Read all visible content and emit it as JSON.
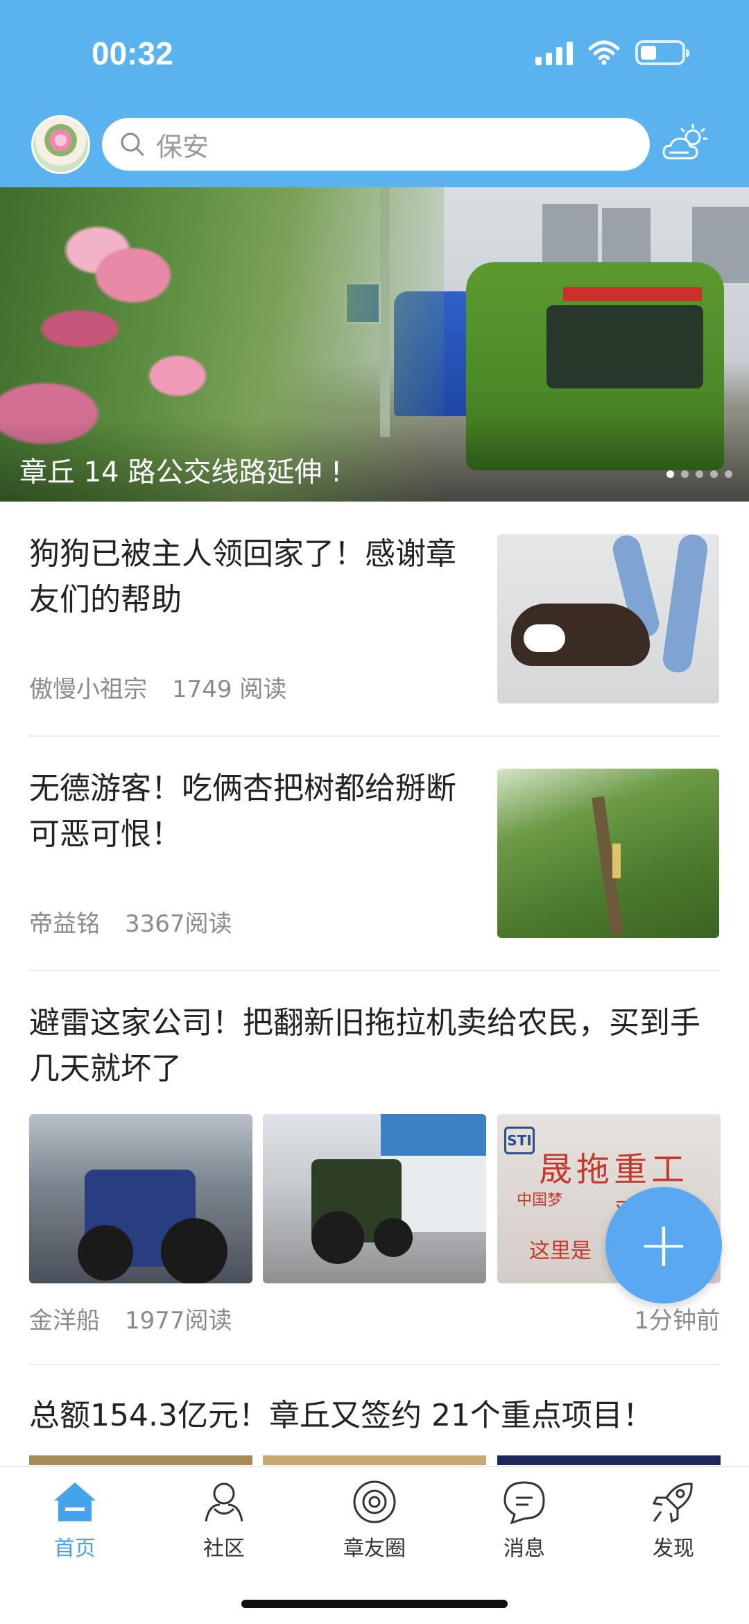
{
  "status_bar": {
    "time": "00:32"
  },
  "header": {
    "search_placeholder": "保安",
    "icons": [
      "avatar",
      "search-icon",
      "weather-cloud-sun-icon"
    ]
  },
  "banner": {
    "caption": "章丘 14 路公交线路延伸 !",
    "slide_count": 5,
    "active_slide": 1
  },
  "articles": [
    {
      "title": "狗狗已被主人领回家了！感谢章友们的帮助",
      "author": "傲慢小祖宗",
      "reads": "1749 阅读"
    },
    {
      "title": "无德游客！吃俩杏把树都给掰断可恶可恨！",
      "author": "帝益铭",
      "reads": "3367阅读"
    },
    {
      "title": "避雷这家公司！把翻新旧拖拉机卖给农民，买到手几天就坏了",
      "author": "金洋船",
      "reads": "1977阅读",
      "time": "1分钟前"
    },
    {
      "title": "总额154.3亿元！章丘又签约 21个重点项目！"
    }
  ],
  "image_text": {
    "sign_big": "晟拖重工",
    "sign_small": "中国梦",
    "sign_mid": "欢",
    "sign_bottom": "这里是",
    "logo": "STI"
  },
  "fab": {
    "label": "+"
  },
  "tabbar": [
    {
      "label": "首页",
      "icon": "home-icon",
      "active": true
    },
    {
      "label": "社区",
      "icon": "community-icon",
      "active": false
    },
    {
      "label": "章友圈",
      "icon": "friends-circle-icon",
      "active": false
    },
    {
      "label": "消息",
      "icon": "message-icon",
      "active": false
    },
    {
      "label": "发现",
      "icon": "rocket-icon",
      "active": false
    }
  ],
  "colors": {
    "header": "#5ab2ef",
    "accent": "#46a2ea",
    "fab": "#5aa8f0"
  }
}
